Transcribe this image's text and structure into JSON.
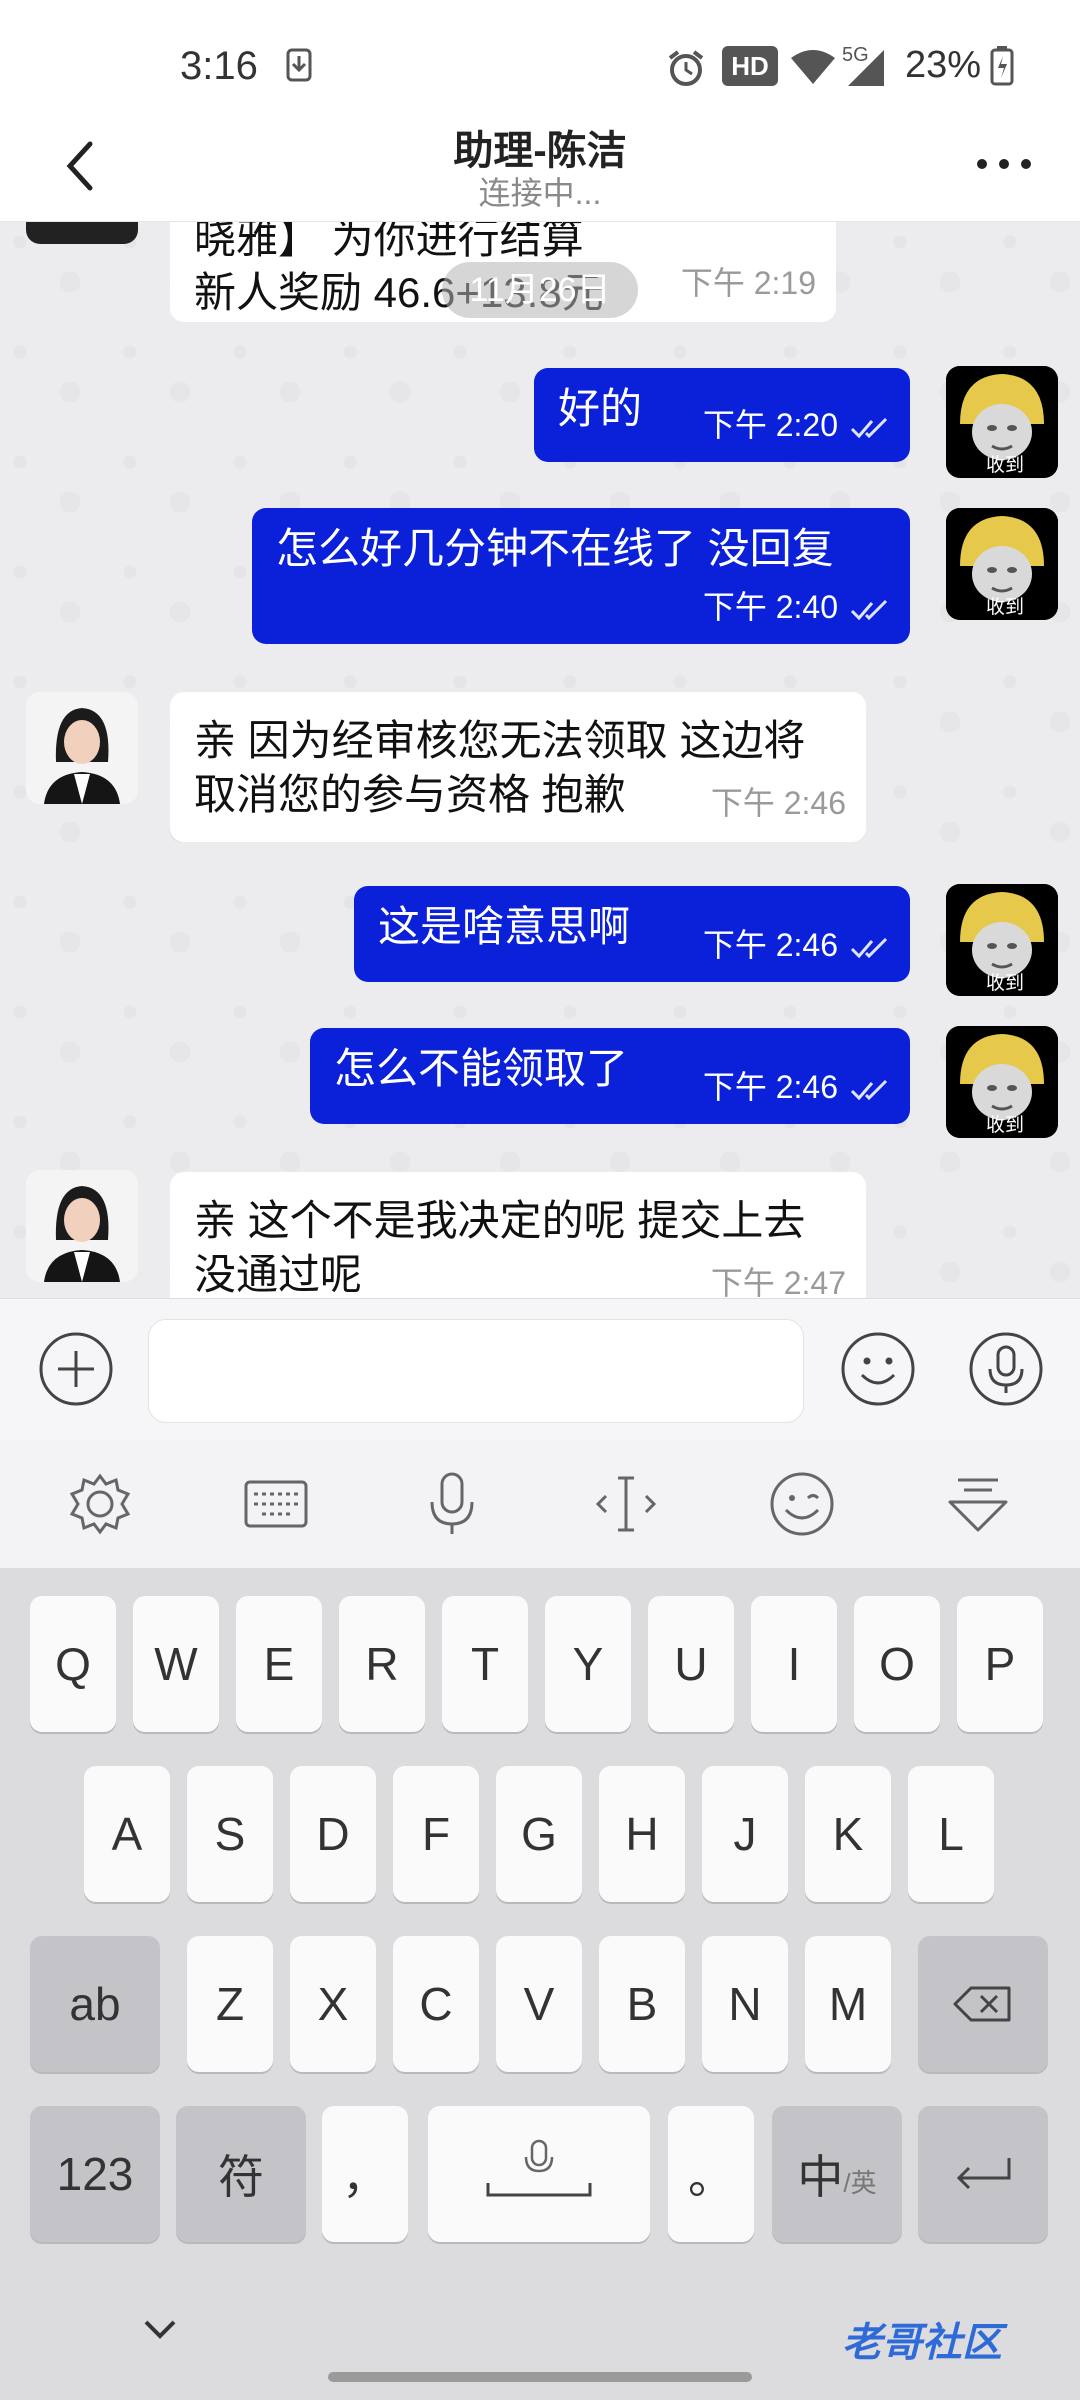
{
  "status_bar": {
    "time": "3:16",
    "network": "5G",
    "hd": "HD",
    "battery": "23%"
  },
  "header": {
    "title": "助理-陈洁",
    "subtitle": "连接中..."
  },
  "date_pill": "11月26日",
  "messages": [
    {
      "dir": "in",
      "text": "晓雅】 为你进行结算新人奖励 46.6+13.8元",
      "time": "下午 2:19"
    },
    {
      "dir": "out",
      "text": "好的",
      "time": "下午 2:20",
      "avatar_label": "收到"
    },
    {
      "dir": "out",
      "text": "怎么好几分钟不在线了 没回复",
      "time": "下午 2:40",
      "avatar_label": "收到"
    },
    {
      "dir": "in",
      "text": "亲 因为经审核您无法领取 这边将取消您的参与资格 抱歉",
      "time": "下午 2:46"
    },
    {
      "dir": "out",
      "text": "这是啥意思啊",
      "time": "下午 2:46",
      "avatar_label": "收到"
    },
    {
      "dir": "out",
      "text": "怎么不能领取了",
      "time": "下午 2:46",
      "avatar_label": "收到"
    },
    {
      "dir": "in",
      "text": "亲 这个不是我决定的呢 提交上去没通过呢",
      "time": "下午 2:47"
    }
  ],
  "input": {
    "placeholder": ""
  },
  "keyboard": {
    "row1": [
      "Q",
      "W",
      "E",
      "R",
      "T",
      "Y",
      "U",
      "I",
      "O",
      "P"
    ],
    "row2": [
      "A",
      "S",
      "D",
      "F",
      "G",
      "H",
      "J",
      "K",
      "L"
    ],
    "row3": [
      "ab",
      "Z",
      "X",
      "C",
      "V",
      "B",
      "N",
      "M"
    ],
    "row4": [
      "123",
      "符",
      "，",
      "。"
    ],
    "lang_key_main": "中",
    "lang_key_sub": "/英"
  },
  "watermark": "老哥社区",
  "colors": {
    "outgoing_bubble": "#0a20d9",
    "incoming_bubble": "#ffffff"
  }
}
